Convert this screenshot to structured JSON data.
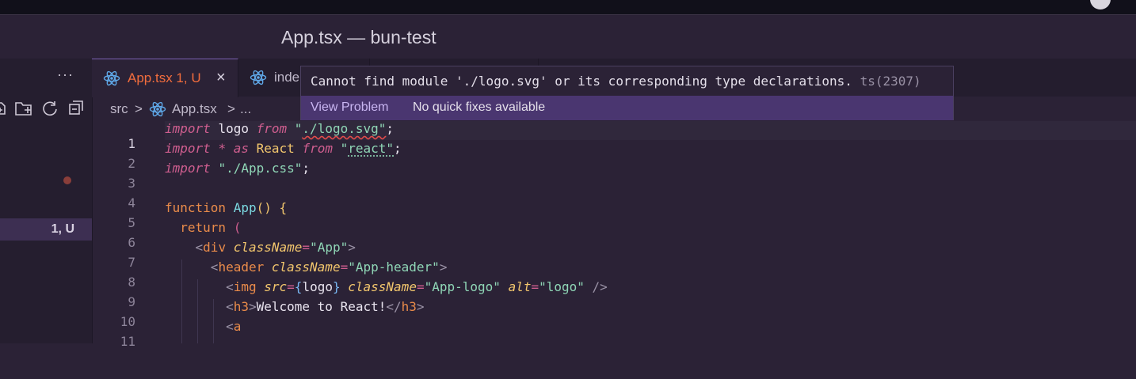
{
  "window": {
    "title": "App.tsx — bun-test"
  },
  "sidebar": {
    "more_label": "···",
    "selected_badge": "1, U"
  },
  "tabs": [
    {
      "label": "App.tsx 1, U",
      "close": "×",
      "active": true
    },
    {
      "label": "inde",
      "active": false
    }
  ],
  "breadcrumb": {
    "folder": "src",
    "sep": ">",
    "file": "App.tsx",
    "more": "..."
  },
  "hover": {
    "message": "Cannot find module './logo.svg' or its corresponding type declarations.",
    "code": "ts(2307)",
    "view_problem": "View Problem",
    "no_fixes": "No quick fixes available"
  },
  "editor": {
    "active_line": 1,
    "line_numbers": [
      "1",
      "2",
      "3",
      "4",
      "5",
      "6",
      "7",
      "8",
      "9",
      "10",
      "11"
    ],
    "lines": [
      "import logo from \"./logo.svg\";",
      "import * as React from \"react\";",
      "import \"./App.css\";",
      "",
      "function App() {",
      "  return (",
      "    <div className=\"App\">",
      "      <header className=\"App-header\">",
      "        <img src={logo} className=\"App-logo\" alt=\"logo\" />",
      "        <h3>Welcome to React!</h3>",
      "        <a"
    ],
    "tokens": {
      "import": "import",
      "from": "from",
      "as": "as",
      "star": "*",
      "logo": "logo",
      "react_id": "React",
      "logo_str_q1": "\"",
      "logo_str_body": "./logo.svg\"",
      "react_str_q1": "\"",
      "react_str_body": "react\"",
      "css_str": "\"./App.css\"",
      "semi": ";",
      "function": "function",
      "app_fn": "App",
      "parens": "()",
      "brace_open": "{",
      "return": "return",
      "paren_open": "(",
      "lt": "<",
      "gt": ">",
      "div": "div",
      "header": "header",
      "img": "img",
      "h3": "h3",
      "a": "a",
      "classname": "className",
      "eq": "=",
      "app_cls": "\"App\"",
      "app_header_cls": "\"App-header\"",
      "src": "src",
      "brace_l": "{",
      "brace_r": "}",
      "app_logo_cls": "\"App-logo\"",
      "alt": "alt",
      "alt_val": "\"logo\"",
      "selfclose": " />",
      "close_h3": "</",
      "welcome": "Welcome to React!"
    }
  }
}
